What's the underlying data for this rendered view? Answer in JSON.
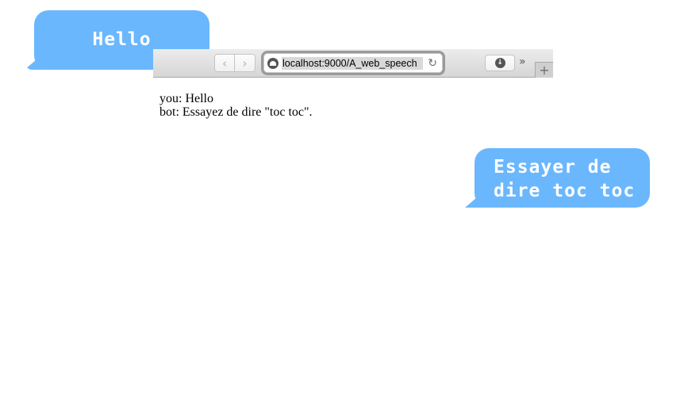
{
  "bubbles": {
    "user_text": "Hello",
    "bot_text": "Essayer de\ndire toc toc",
    "color": "#6ab7fe"
  },
  "browser": {
    "back_icon": "chevron-left-icon",
    "forward_icon": "chevron-right-icon",
    "url": "localhost:9000/A_web_speech",
    "reload_icon": "reload-icon",
    "download_icon": "download-icon",
    "overflow_icon": "chevron-double-right-icon",
    "new_tab_icon": "plus-icon"
  },
  "chat": {
    "lines": [
      "you: Hello",
      "bot: Essayez de dire \"toc toc\"."
    ]
  }
}
